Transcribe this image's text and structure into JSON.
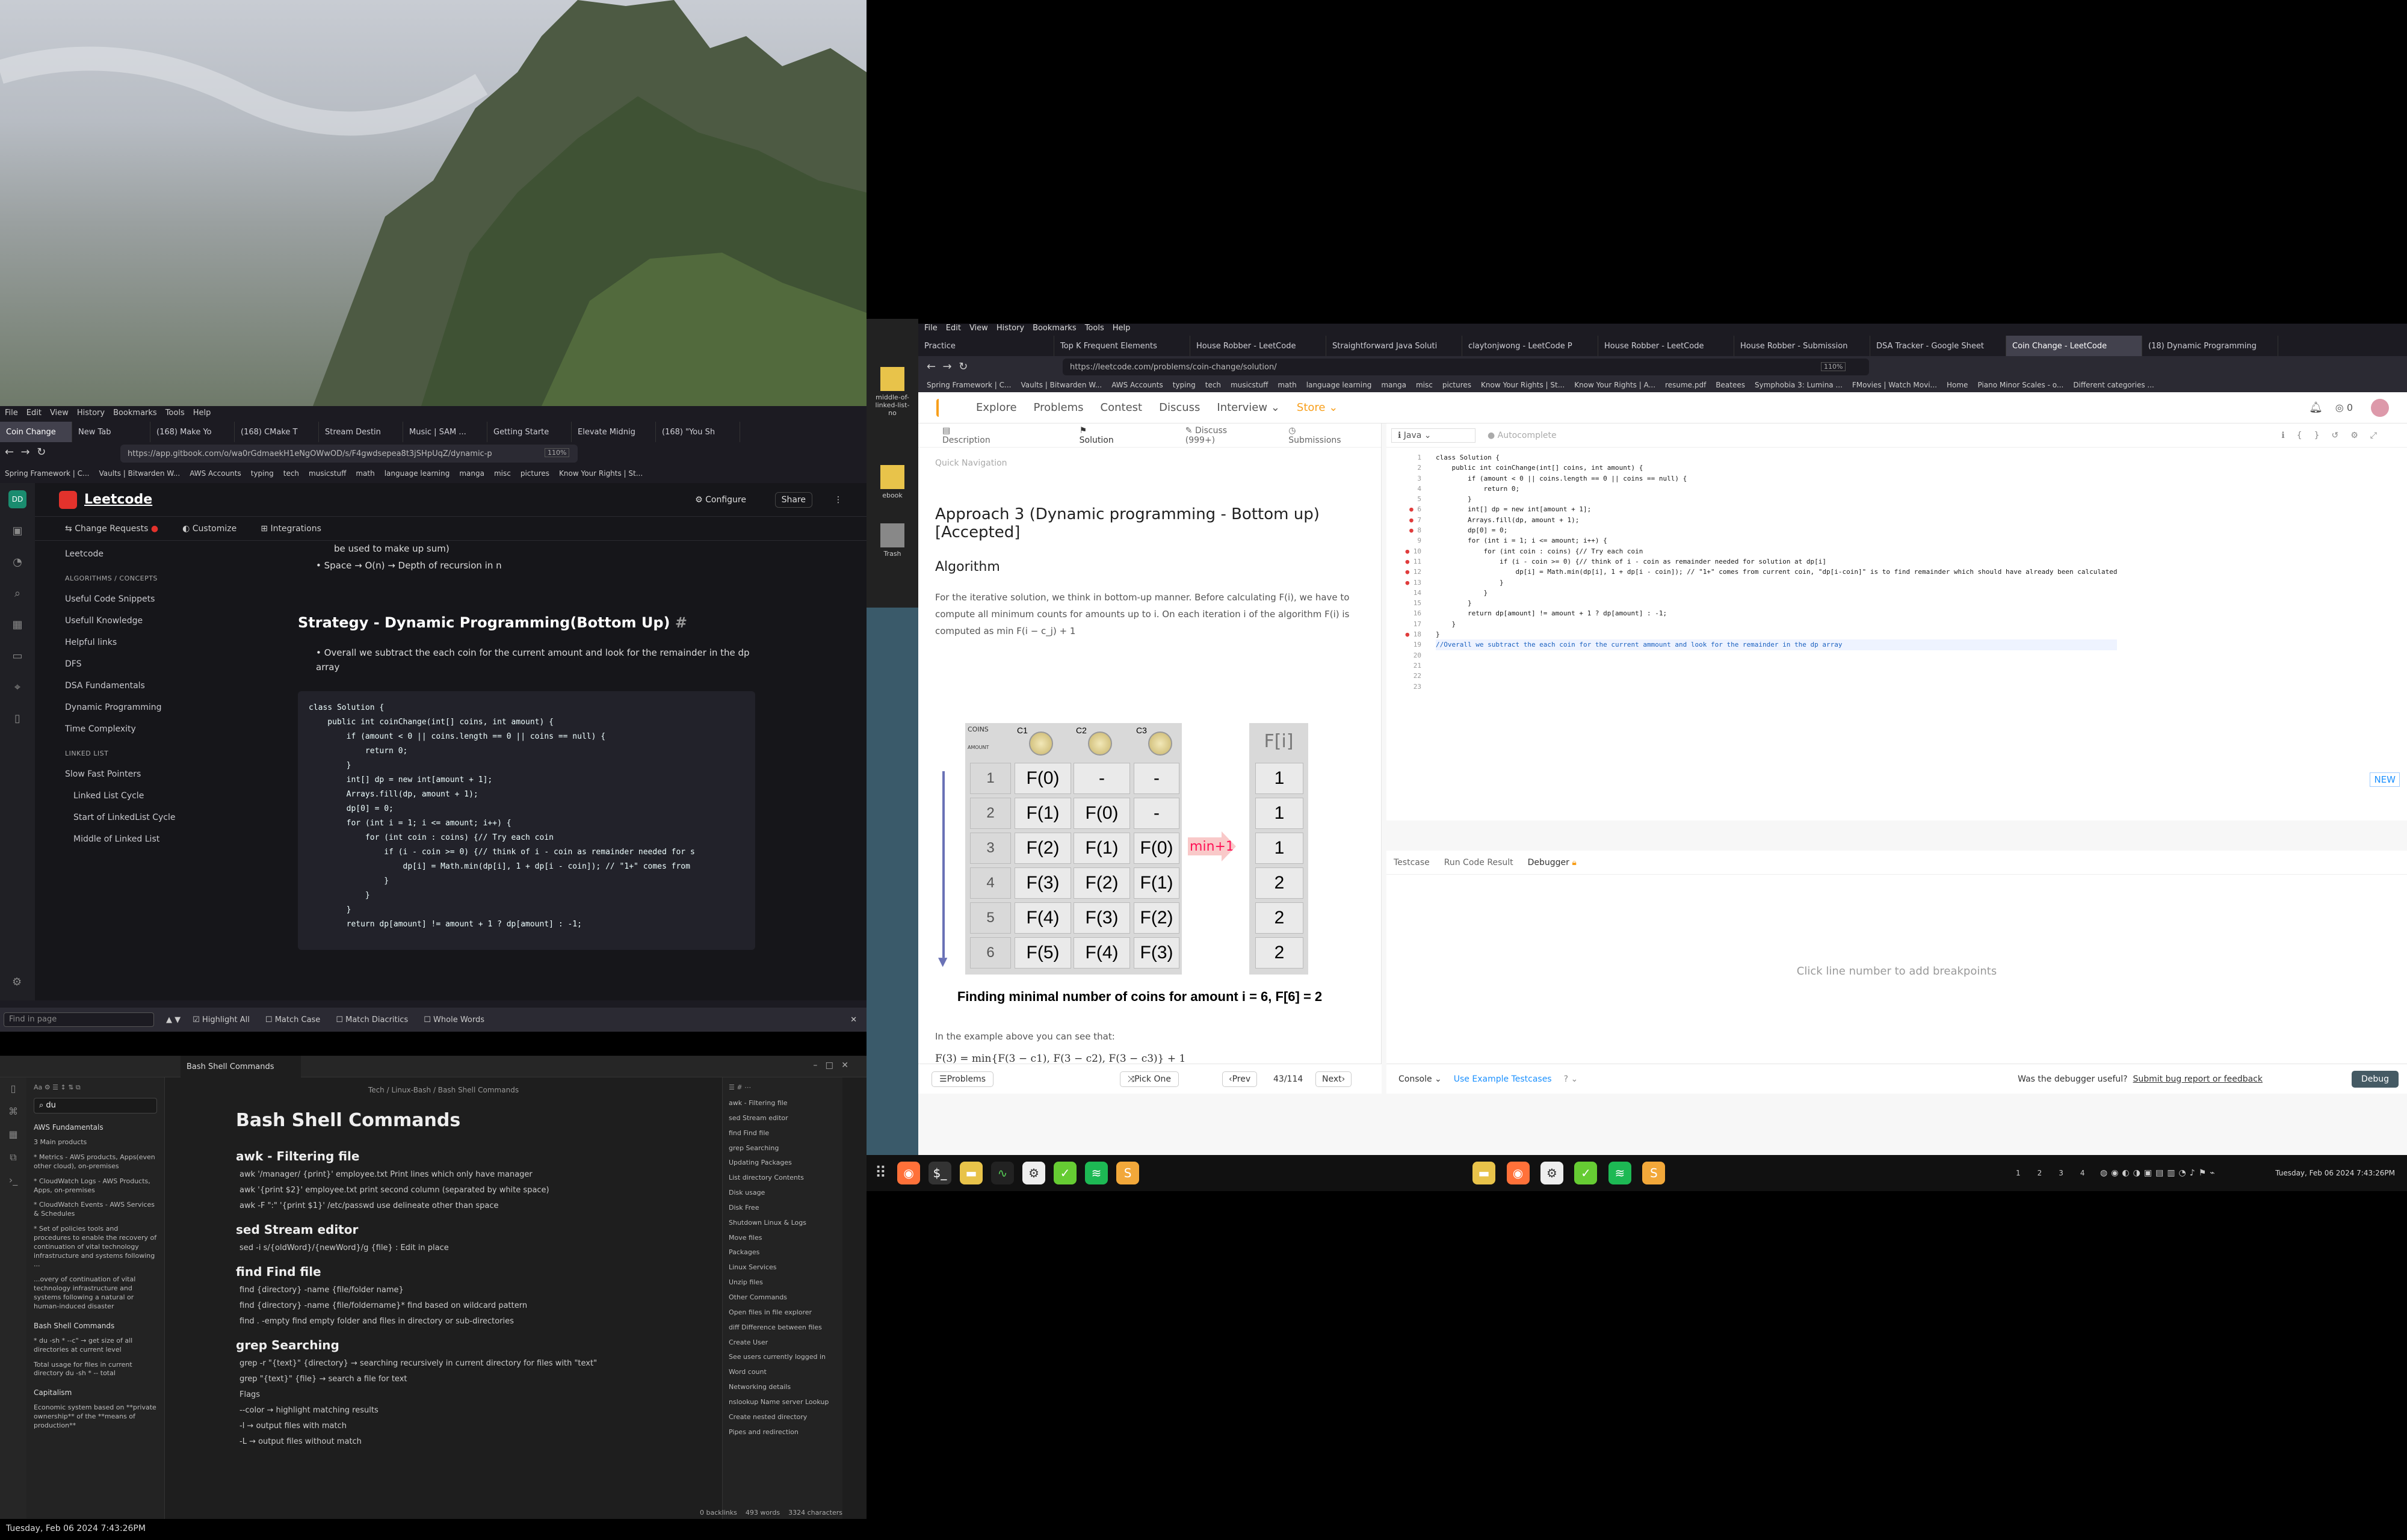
{
  "wallpaper": {
    "alt_hint": ""
  },
  "left_browser": {
    "menu": [
      "File",
      "Edit",
      "View",
      "History",
      "Bookmarks",
      "Tools",
      "Help"
    ],
    "tabs": [
      "Coin Change",
      "New Tab",
      "(168) Make Yo",
      "(168) CMake T",
      "Stream Destin",
      "Music | SAM ...",
      "Getting Starte",
      "Elevate Midnig",
      "(168) \"You Sh"
    ],
    "url": "https://app.gitbook.com/o/wa0rGdmaekH1eNgOWwOD/s/F4gwdsepea8t3jSHpUqZ/dynamic-p",
    "zoom": "110%",
    "bookmarks": [
      "Spring Framework | C...",
      "Vaults | Bitwarden W...",
      "AWS Accounts",
      "typing",
      "tech",
      "musicstuff",
      "math",
      "language learning",
      "manga",
      "misc",
      "pictures",
      "Know Your Rights | St..."
    ],
    "site_title": "Leetcode",
    "configure": "Configure",
    "share": "Share",
    "subnav": [
      "Change Requests",
      "Customize",
      "Integrations"
    ],
    "sidebar": [
      "Leetcode",
      "ALGORITHMS / CONCEPTS",
      "Useful Code Snippets",
      "Usefull Knowledge",
      "Helpful links",
      "DFS",
      "DSA Fundamentals",
      "Dynamic Programming",
      "Time Complexity",
      "LINKED LIST",
      "Slow Fast Pointers",
      "Linked List Cycle",
      "Start of LinkedList Cycle",
      "Middle of Linked List"
    ],
    "doc_pre": "be used to make up sum)",
    "doc_bullet1": "Space → O(n) → Depth of recursion in n",
    "doc_heading": "Strategy - Dynamic Programming(Bottom Up)",
    "doc_bullet2": "Overall we subtract the each coin for the current amount and look for the remainder in the dp array",
    "code_lines": [
      "class Solution {",
      "    public int coinChange(int[] coins, int amount) {",
      "        if (amount < 0 || coins.length == 0 || coins == null) {",
      "            return 0;",
      "        }",
      "        int[] dp = new int[amount + 1];",
      "        Arrays.fill(dp, amount + 1);",
      "        dp[0] = 0;",
      "",
      "        for (int i = 1; i <= amount; i++) {",
      "            for (int coin : coins) {// Try each coin",
      "                if (i - coin >= 0) {// think of i - coin as remainder needed for s",
      "                    dp[i] = Math.min(dp[i], 1 + dp[i - coin]); // \"1+\" comes from",
      "                }",
      "            }",
      "        }",
      "",
      "        return dp[amount] != amount + 1 ? dp[amount] : -1;"
    ],
    "find_placeholder": "Find in page",
    "find_options": [
      "Highlight All",
      "Match Case",
      "Match Diacritics",
      "Whole Words"
    ]
  },
  "obsidian": {
    "tab": "Bash Shell Commands",
    "breadcrumb": "Tech / Linux-Bash / Bash Shell Commands",
    "search_value": "du",
    "left_results": [
      "AWS Fundamentals",
      "3 Main products",
      "* Metrics - AWS products, Apps(even other cloud), on-premises",
      "* CloudWatch Logs - AWS Products, Apps, on-premises",
      "* CloudWatch Events - AWS Services & Schedules",
      "* Set of policies tools and procedures to enable the recovery of continuation of vital technology infrastructure and systems following ...",
      "...overy of continuation of vital technology infrastructure and systems following a natural or human-induced disaster",
      "Bash Shell Commands",
      "* du -sh * --c\" → get size of all directories at current level",
      "Total usage for files in current directory du -sh * -- total",
      "Capitalism",
      "Economic system based on **private ownership** of the **means of production**"
    ],
    "title": "Bash Shell Commands",
    "sections": [
      {
        "h": "awk - Filtering file",
        "items": [
          "awk '/manager/ {print}' employee.txt Print lines which only have manager",
          "awk '{print $2}' employee.txt print second column (separated by white space)",
          "awk -F \":\" '{print $1}' /etc/passwd use delineate other than space"
        ]
      },
      {
        "h": "sed Stream editor",
        "items": [
          "sed -i s/{oldWord}/{newWord}/g {file} : Edit in place"
        ]
      },
      {
        "h": "find Find file",
        "items": [
          "find {directory} -name {file/folder name}",
          "find {directory} -name {file/foldername}* find based on wildcard pattern",
          "find . -empty find empty folder and files in directory or sub-directories"
        ]
      },
      {
        "h": "grep Searching",
        "items": [
          "grep -r \"{text}\" {directory} → searching recursively in current directory for files with \"text\"",
          "grep \"{text}\" {file} → search a file for text",
          "Flags",
          "--color → highlight matching results",
          "-l → output files with match",
          "-L → output files without match"
        ]
      }
    ],
    "outline": [
      "awk - Filtering file",
      "sed Stream editor",
      "find Find file",
      "grep Searching",
      "Updating Packages",
      "List directory Contents",
      "Disk usage",
      "Disk Free",
      "Shutdown Linux & Logs",
      "Move files",
      "Packages",
      "Linux Services",
      "Unzip files",
      "Other Commands",
      "Open files in file explorer",
      "diff Difference between files",
      "Create User",
      "See users currently logged in",
      "Word count",
      "Networking details",
      "nslookup Name server Lookup",
      "Create nested directory",
      "Pipes and redirection"
    ],
    "status": [
      "0 backlinks",
      "493 words",
      "3324 characters"
    ]
  },
  "bottom_clock": "Tuesday, Feb 06 2024  7:43:26PM",
  "right_browser": {
    "menu": [
      "File",
      "Edit",
      "View",
      "History",
      "Bookmarks",
      "Tools",
      "Help"
    ],
    "tabs": [
      "Practice",
      "Top K Frequent Elements",
      "House Robber - LeetCode",
      "Straightforward Java Soluti",
      "claytonjwong - LeetCode P",
      "House Robber - LeetCode",
      "House Robber - Submission",
      "DSA Tracker - Google Sheet",
      "Coin Change - LeetCode",
      "(18) Dynamic Programming"
    ],
    "url": "https://leetcode.com/problems/coin-change/solution/",
    "zoom": "110%",
    "bookmarks": [
      "Spring Framework | C...",
      "Vaults | Bitwarden W...",
      "AWS Accounts",
      "typing",
      "tech",
      "musicstuff",
      "math",
      "language learning",
      "manga",
      "misc",
      "pictures",
      "Know Your Rights | St...",
      "Know Your Rights | A...",
      "resume.pdf",
      "Beatees",
      "Symphobia 3: Lumina ...",
      "FMovies | Watch Movi...",
      "Home",
      "Piano Minor Scales - o...",
      "Different categories ..."
    ],
    "lc_nav": [
      "Explore",
      "Problems",
      "Contest",
      "Discuss",
      "Interview",
      "Store"
    ],
    "coins": "0",
    "lc_tabs": [
      "Description",
      "Solution",
      "Discuss (999+)",
      "Submissions"
    ],
    "quick_nav": "Quick Navigation",
    "approach": "Approach 3 (Dynamic programming - Bottom up) [Accepted]",
    "algorithm": "Algorithm",
    "para": "For the iterative solution, we think in bottom-up manner. Before calculating F(i), we have to compute all minimum counts for amounts up to i. On each iteration i of the algorithm F(i) is computed as min F(i − c_j) + 1",
    "table": {
      "header_coins": "COINS",
      "header_amount": "AMOUNT",
      "coin_labels": [
        "C1",
        "C2",
        "C3"
      ],
      "fi": "F[i]",
      "rows": [
        {
          "i": "1",
          "c1": "F(0)",
          "c2": "-",
          "c3": "-",
          "f": "1"
        },
        {
          "i": "2",
          "c1": "F(1)",
          "c2": "F(0)",
          "c3": "-",
          "f": "1"
        },
        {
          "i": "3",
          "c1": "F(2)",
          "c2": "F(1)",
          "c3": "F(0)",
          "f": "1"
        },
        {
          "i": "4",
          "c1": "F(3)",
          "c2": "F(2)",
          "c3": "F(1)",
          "f": "2"
        },
        {
          "i": "5",
          "c1": "F(4)",
          "c2": "F(3)",
          "c3": "F(2)",
          "f": "2"
        },
        {
          "i": "6",
          "c1": "F(5)",
          "c2": "F(4)",
          "c3": "F(3)",
          "f": "2"
        }
      ],
      "min_label": "min+1"
    },
    "caption": "Finding minimal number of coins for amount i = 6, F[6] = 2",
    "example_line": "In the example above you can see that:",
    "math_lines": [
      "F(3) = min{F(3 − c1), F(3 − c2), F(3 − c3)} + 1",
      "= min{F(3 − 1), F(3 − 2), F(3 − 3)} + 1",
      "= min{F(2), F(1), F(0)} + 1",
      "= min{1, 1, 0} + 1"
    ],
    "footer": {
      "problems": "Problems",
      "pick_one": "Pick One",
      "prev": "Prev",
      "page": "43/114",
      "next": "Next"
    },
    "editor_lang": "Java",
    "autocomplete": "Autocomplete",
    "editor_code": [
      "class Solution {",
      "    public int coinChange(int[] coins, int amount) {",
      "        if (amount < 0 || coins.length == 0 || coins == null) {",
      "            return 0;",
      "        }",
      "        int[] dp = new int[amount + 1];",
      "        Arrays.fill(dp, amount + 1);",
      "        dp[0] = 0;",
      "",
      "        for (int i = 1; i <= amount; i++) {",
      "            for (int coin : coins) {// Try each coin",
      "                if (i - coin >= 0) {// think of i - coin as remainder needed for solution at dp[i]",
      "                    dp[i] = Math.min(dp[i], 1 + dp[i - coin]); // \"1+\" comes from current coin, \"dp[i-coin]\" is to find remainder which should have already been calculated",
      "                }",
      "            }",
      "        }",
      "",
      "        return dp[amount] != amount + 1 ? dp[amount] : -1;",
      "",
      "    }",
      "}",
      "",
      "//Overall we subtract the each coin for the current ammount and look for the remainder in the dp array"
    ],
    "new_badge": "NEW",
    "debug_tabs": [
      "Testcase",
      "Run Code Result",
      "Debugger"
    ],
    "debug_hint": "Click line number to add breakpoints",
    "console": "Console",
    "use_example": "Use Example Testcases",
    "was_useful": "Was the debugger useful?",
    "submit_bug": "Submit bug report or feedback",
    "debug_btn": "Debug"
  },
  "desktop_icons": [
    "middle-of-linked-list-no",
    "icon2",
    "ebook",
    "Trash"
  ],
  "taskbar": {
    "workspaces": [
      "1",
      "2",
      "3",
      "4"
    ],
    "clock": "Tuesday, Feb 06 2024  7:43:26PM"
  }
}
